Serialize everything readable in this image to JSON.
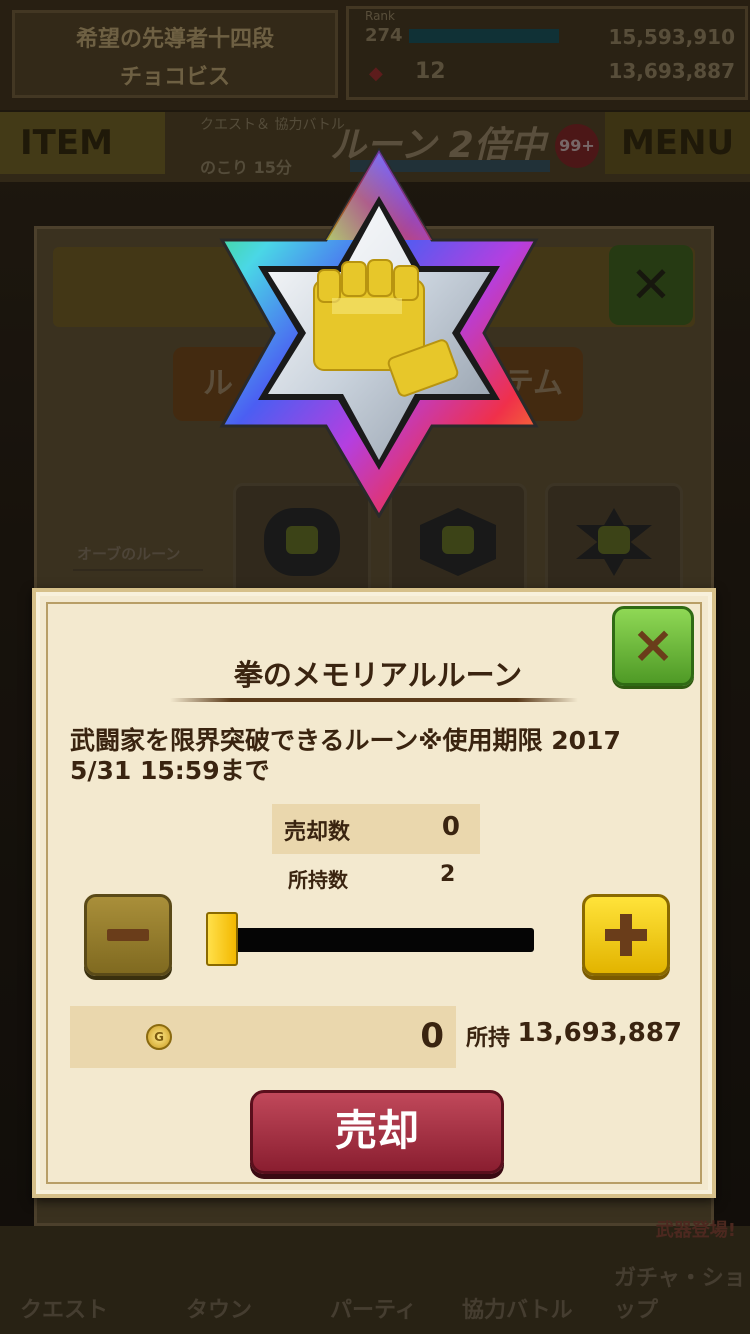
{
  "header": {
    "player_title": "希望の先導者十四段",
    "player_name": "チョコビス",
    "rank_label": "Rank",
    "rank_value": "274",
    "gold_top": "15,593,910",
    "gem_count": "12",
    "gold": "13,693,887"
  },
  "nav": {
    "item_label": "ITEM",
    "quest_info": "クエスト＆ 協力バトル",
    "rune_label": "ルーン",
    "multiplier": "2倍中",
    "remaining_label": "のこり",
    "remaining_time": "15分",
    "badge_count": "99+",
    "menu_label": "MENU"
  },
  "background_panel": {
    "tab_left": "ル",
    "tab_right": "テム",
    "section_label": "オーブのルーン"
  },
  "bottom_nav": {
    "items": [
      "クエスト",
      "タウン",
      "パーティ",
      "協力バトル",
      "ガチャ・ショップ"
    ],
    "weapon_tag": "武器登場!"
  },
  "popup": {
    "close_icon": "×",
    "title": "拳のメモリアルルーン",
    "description": "武闘家を限界突破できるルーン※使用期限 2017\n5/31 15:59まで",
    "sell_count_label": "売却数",
    "sell_count_value": "0",
    "owned_label": "所持数",
    "owned_value": "2",
    "slider_fraction": 0,
    "coin_icon": "G",
    "price_value": "0",
    "holding_label": "所持",
    "holding_value": "13,693,887",
    "sell_button_label": "売却"
  },
  "colors": {
    "popup_bg": "#f3e9cf",
    "close_green": "#6fbe3a",
    "plus_yellow": "#f6cc10",
    "sell_red": "#a8334a"
  }
}
